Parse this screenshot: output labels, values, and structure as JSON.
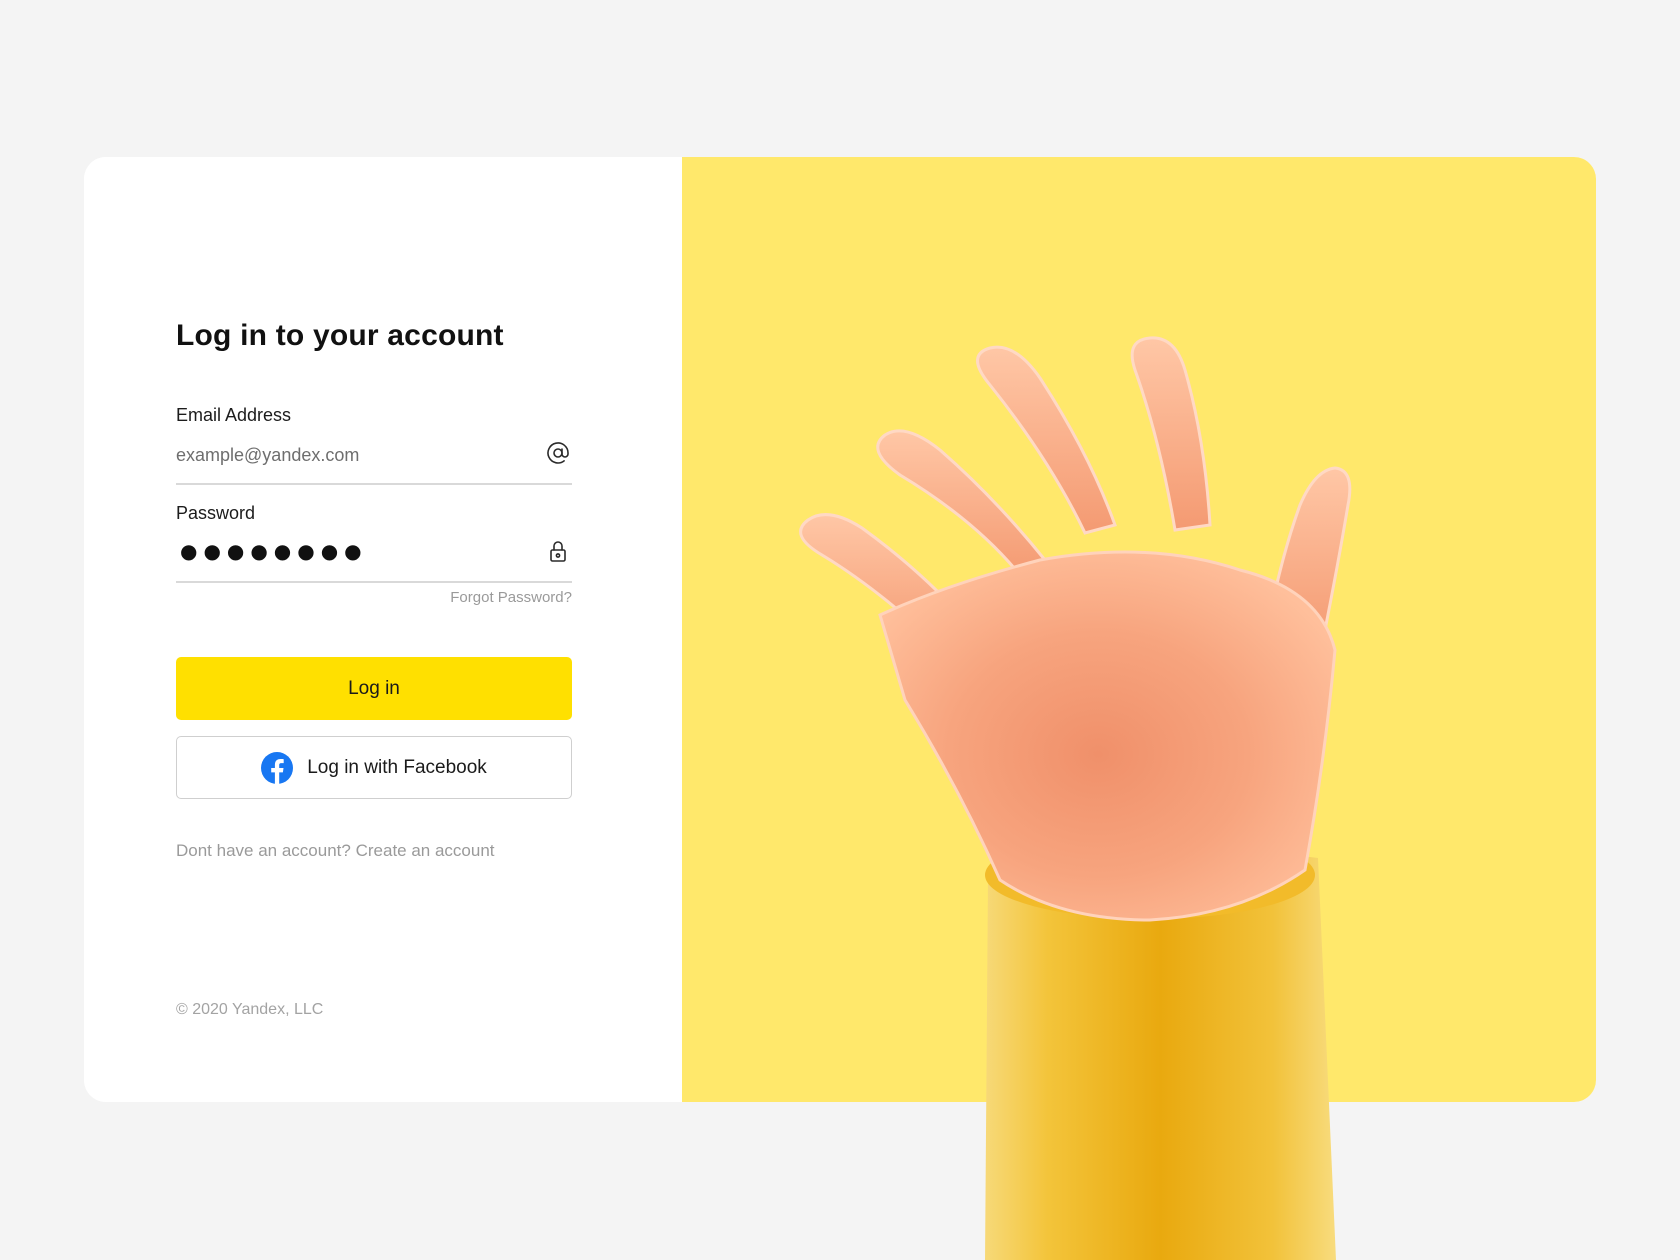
{
  "login": {
    "title": "Log in to your account",
    "email": {
      "label": "Email Address",
      "placeholder": "example@yandex.com",
      "icon": "at-sign-icon"
    },
    "password": {
      "label": "Password",
      "masked_value": "●●●●●●●●",
      "icon": "lock-icon"
    },
    "forgot_password": "Forgot Password?",
    "login_button": "Log in",
    "facebook_button": "Log in with Facebook",
    "signup_prompt": "Dont have an account?",
    "signup_link": "Create an account",
    "copyright": "© 2020  Yandex, LLC"
  },
  "colors": {
    "page_background": "#f4f4f4",
    "card_background": "#ffffff",
    "illustration_background": "#ffe86b",
    "primary_button": "#ffe000",
    "facebook_blue": "#1877f2",
    "muted_text": "#9a9a9a"
  },
  "illustration": {
    "subject": "waving-hand-icon"
  }
}
